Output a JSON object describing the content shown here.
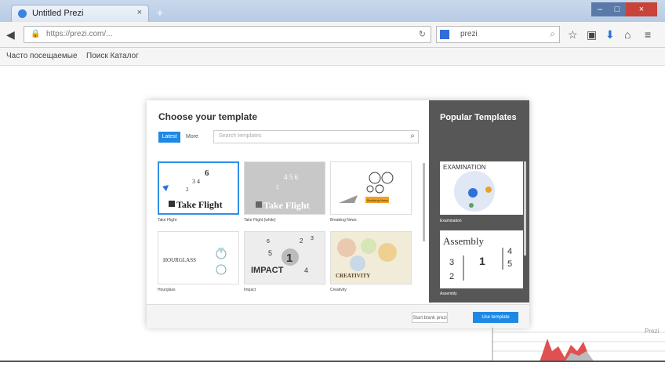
{
  "browser": {
    "tab_title": "Untitled Prezi",
    "tab_close": "×",
    "new_tab": "+",
    "url": "https://prezi.com/...",
    "search_value": "prezi",
    "bookmarks": [
      "Часто посещаемые",
      "Поиск Каталог"
    ]
  },
  "modal": {
    "title": "Choose your template",
    "tab_latest": "Latest",
    "tab_more": "More",
    "search_placeholder": "Search templates",
    "templates": [
      {
        "name": "Take Flight",
        "caption": "Take Flight"
      },
      {
        "name": "Take Flight (white)",
        "caption": "Take Flight"
      },
      {
        "name": "Breaking News",
        "caption": "Breaking News"
      },
      {
        "name": "Hourglass",
        "caption": "HOURGLASS"
      },
      {
        "name": "Impact",
        "caption": "IMPACT"
      },
      {
        "name": "Creativity",
        "caption": "CREATIVITY"
      }
    ],
    "popular_title": "Popular Templates",
    "popular": [
      {
        "name": "Examination",
        "caption": "EXAMINATION"
      },
      {
        "name": "Assembly",
        "caption": "Assembly"
      }
    ],
    "start_blank": "Start blank prezi",
    "use_template": "Use template"
  },
  "graph": {
    "label": "Prezi"
  }
}
